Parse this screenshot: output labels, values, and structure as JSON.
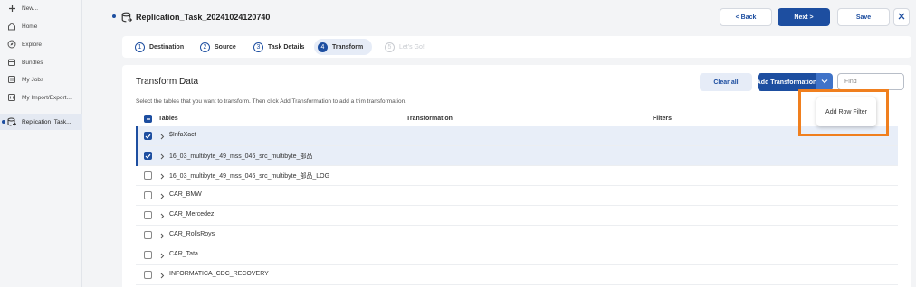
{
  "sidebar": {
    "items": [
      {
        "label": "New...",
        "icon": "plus-icon"
      },
      {
        "label": "Home",
        "icon": "home-icon"
      },
      {
        "label": "Explore",
        "icon": "compass-icon"
      },
      {
        "label": "Bundles",
        "icon": "bundles-icon"
      },
      {
        "label": "My Jobs",
        "icon": "jobs-icon"
      },
      {
        "label": "My Import/Export...",
        "icon": "import-export-icon"
      },
      {
        "label": "Replication_Task...",
        "icon": "replication-task-icon"
      }
    ]
  },
  "header": {
    "title": "Replication_Task_20241024120740",
    "back_label": "< Back",
    "next_label": "Next >",
    "save_label": "Save",
    "close_icon": "close-icon"
  },
  "stepper": {
    "steps": [
      {
        "num": "1",
        "label": "Destination",
        "state": "done"
      },
      {
        "num": "2",
        "label": "Source",
        "state": "done"
      },
      {
        "num": "3",
        "label": "Task Details",
        "state": "done"
      },
      {
        "num": "4",
        "label": "Transform",
        "state": "active"
      },
      {
        "num": "5",
        "label": "Let's Go!",
        "state": "disabled"
      }
    ]
  },
  "transform": {
    "title": "Transform Data",
    "instructions": "Select the tables that you want to transform. Then click Add Transformation to add a trim transformation.",
    "clear_all_label": "Clear all",
    "add_transformation_label": "Add Transformation",
    "find_placeholder": "Find",
    "dropdown_item": "Add Row Filter",
    "columns": [
      "Tables",
      "Transformation",
      "Filters"
    ],
    "rows": [
      {
        "name": "$InfaXact",
        "checked": true
      },
      {
        "name": "16_03_multibyte_49_mss_046_src_multibyte_部品",
        "checked": true
      },
      {
        "name": "16_03_multibyte_49_mss_046_src_multibyte_部品_LOG",
        "checked": false
      },
      {
        "name": "CAR_BMW",
        "checked": false
      },
      {
        "name": "CAR_Mercedez",
        "checked": false
      },
      {
        "name": "CAR_RollsRoys",
        "checked": false
      },
      {
        "name": "CAR_Tata",
        "checked": false
      },
      {
        "name": "INFORMATICA_CDC_RECOVERY",
        "checked": false
      }
    ]
  },
  "colors": {
    "accent": "#1d4ea0",
    "highlight": "#f07f1e",
    "selected_row": "#e8eef8"
  }
}
